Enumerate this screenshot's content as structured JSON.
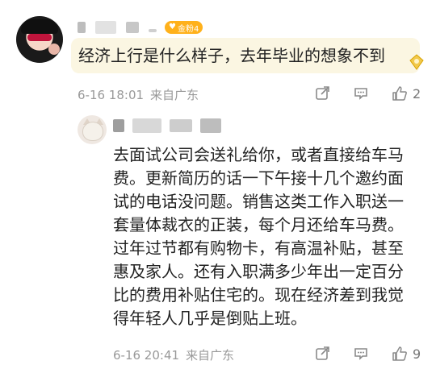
{
  "main_comment": {
    "badge_label": "金粉4",
    "text": "经济上行是什么样子，去年毕业的想象不到",
    "time": "6-16 18:01",
    "location": "来自广东",
    "like_count": "2"
  },
  "reply": {
    "text": "去面试公司会送礼给你，或者直接给车马费。更新简历的话一下午接十几个邀约面试的电话没问题。销售这类工作入职送一套量体裁衣的正装，每个月还给车马费。过年过节都有购物卡，有高温补贴，甚至惠及家人。还有入职满多少年出一定百分比的费用补贴住宅的。现在经济差到我觉得年轻人几乎是倒贴上班。",
    "time": "6-16 20:41",
    "location": "来自广东",
    "like_count": "9"
  },
  "icons": {
    "share": "share-icon",
    "comment": "comment-icon",
    "like": "like-icon",
    "gem": "gem-badge-icon"
  },
  "colors": {
    "badge": "#ffb11b",
    "bubble": "#fbf6e2",
    "meta_text": "#999999"
  }
}
